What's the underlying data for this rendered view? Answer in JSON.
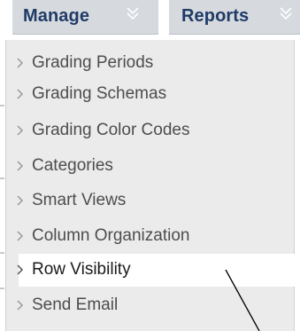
{
  "menubar": {
    "tabs": [
      {
        "label": "Manage",
        "icon": "double-chevron-down-icon"
      },
      {
        "label": "Reports",
        "icon": "double-chevron-down-icon"
      }
    ]
  },
  "menu": {
    "items": [
      {
        "label": "Grading Periods",
        "selected": false
      },
      {
        "label": "Grading Schemas",
        "selected": false
      },
      {
        "label": "Grading Color Codes",
        "selected": false
      },
      {
        "label": "Categories",
        "selected": false
      },
      {
        "label": "Smart Views",
        "selected": false
      },
      {
        "label": "Column Organization",
        "selected": false
      },
      {
        "label": "Row Visibility",
        "selected": true
      },
      {
        "label": "Send Email",
        "selected": false
      }
    ]
  },
  "colors": {
    "tab_bg": "#d6d9de",
    "tab_text": "#1f3b66",
    "menu_bg": "#ebebeb",
    "menu_text": "#4d4d4d",
    "selected_bg": "#ffffff"
  }
}
